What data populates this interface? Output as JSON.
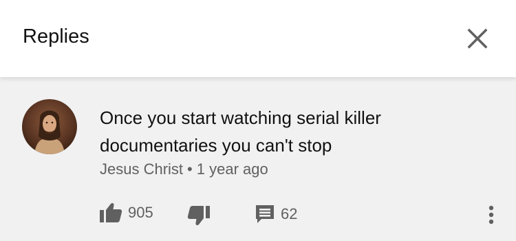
{
  "header": {
    "title": "Replies",
    "close_icon": "close-icon"
  },
  "comment": {
    "text": "Once you start watching serial killer documentaries you can't stop",
    "author": "Jesus Christ",
    "separator": "•",
    "time": "1 year ago",
    "likes": "905",
    "replies": "62"
  },
  "icons": {
    "like": "thumbs-up-icon",
    "dislike": "thumbs-down-icon",
    "reply": "comment-icon",
    "more": "more-vertical-icon"
  },
  "colors": {
    "background": "#f1f1f1",
    "header": "#ffffff",
    "text_primary": "#111111",
    "text_secondary": "#606060",
    "icon": "#606060"
  }
}
